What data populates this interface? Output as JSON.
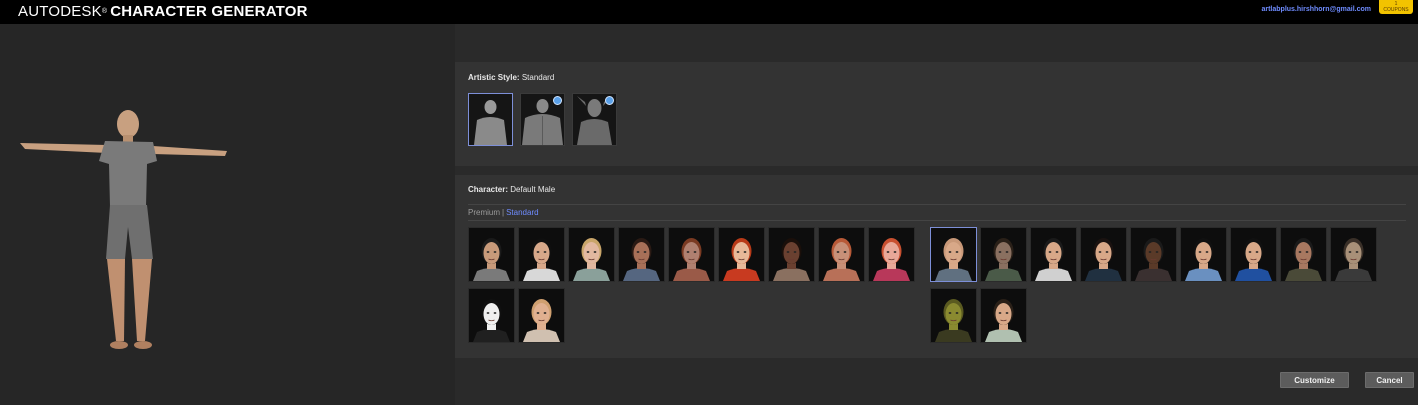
{
  "header": {
    "brand_prefix": "AUTODESK",
    "brand_reg": "®",
    "brand_name": "CHARACTER GENERATOR",
    "user_email": "artlabplus.hirshhorn@gmail.com",
    "coupons_count": "1",
    "coupons_label": "COUPONS"
  },
  "artistic_style": {
    "label": "Artistic Style:",
    "value": "Standard",
    "options": [
      {
        "name": "standard",
        "selected": true,
        "premium": false
      },
      {
        "name": "muscular",
        "selected": false,
        "premium": true
      },
      {
        "name": "creature",
        "selected": false,
        "premium": true
      }
    ]
  },
  "character": {
    "label": "Character:",
    "value": "Default Male",
    "tabs": {
      "premium": "Premium",
      "separator": "|",
      "standard": "Standard"
    },
    "female_faces": [
      {
        "skin": "#c89a7a",
        "hair": "#1a1a1a",
        "shirt": "#7a7a7a"
      },
      {
        "skin": "#d7a88a",
        "hair": "#0f0f0f",
        "shirt": "#d8d8d8"
      },
      {
        "skin": "#e2b8a0",
        "hair": "#c9a56a",
        "shirt": "#8aa09a"
      },
      {
        "skin": "#a87058",
        "hair": "#2a1a14",
        "shirt": "#556680"
      },
      {
        "skin": "#b08070",
        "hair": "#7a3a22",
        "shirt": "#9a5a48"
      },
      {
        "skin": "#e8b898",
        "hair": "#b83a18",
        "shirt": "#c83a20"
      },
      {
        "skin": "#6a4030",
        "hair": "#1a0f0a",
        "shirt": "#8a7060"
      },
      {
        "skin": "#c89078",
        "hair": "#b85a38",
        "shirt": "#b87058"
      },
      {
        "skin": "#e8a898",
        "hair": "#c85030",
        "shirt": "#b8385a"
      },
      {
        "skin": "#f0f0f0",
        "hair": "#101010",
        "shirt": "#202020"
      },
      {
        "skin": "#e0b090",
        "hair": "#d0a070",
        "shirt": "#d0c0b0"
      }
    ],
    "male_faces": [
      {
        "skin": "#d8a888",
        "hair": "#c89878",
        "shirt": "#607080",
        "selected": true
      },
      {
        "skin": "#8a7060",
        "hair": "#2a2018",
        "shirt": "#4a5a48",
        "selected": false
      },
      {
        "skin": "#d8a888",
        "hair": "#1a1a1a",
        "shirt": "#d0d0d0",
        "selected": false
      },
      {
        "skin": "#d8a888",
        "hair": "#1a1210",
        "shirt": "#203040",
        "selected": false
      },
      {
        "skin": "#5a3a28",
        "hair": "#1a1a1a",
        "shirt": "#3a3030",
        "selected": false
      },
      {
        "skin": "#d8a888",
        "hair": "#101010",
        "shirt": "#6a90c0",
        "selected": false
      },
      {
        "skin": "#d8a888",
        "hair": "#101010",
        "shirt": "#2050a0",
        "selected": false
      },
      {
        "skin": "#a87860",
        "hair": "#1a1a1a",
        "shirt": "#4a4a38",
        "selected": false
      },
      {
        "skin": "#a89078",
        "hair": "#3a3028",
        "shirt": "#3a3a3a",
        "selected": false
      },
      {
        "skin": "#8a8a30",
        "hair": "#5a5a20",
        "shirt": "#3a3a20",
        "selected": false
      },
      {
        "skin": "#d8a888",
        "hair": "#2a2018",
        "shirt": "#b0c0b0",
        "selected": false
      }
    ]
  },
  "buttons": {
    "customize": "Customize",
    "cancel": "Cancel"
  }
}
